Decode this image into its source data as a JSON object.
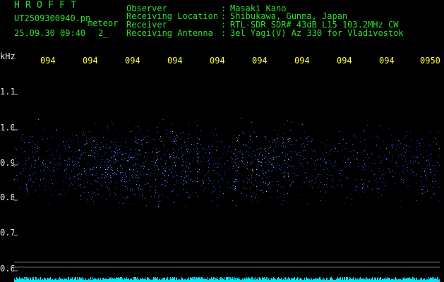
{
  "header": {
    "app_title": "HROFFT",
    "file_name": "UT2509300940.pn",
    "file_suffix": "meteor",
    "timestamp": "25.09.30 09:40",
    "counter": "2_",
    "info": [
      {
        "label": "Observer",
        "sep": ":",
        "value": "Masaki Kano"
      },
      {
        "label": "Receiving Location",
        "sep": ":",
        "value": "Shibukawa, Gunma, Japan"
      },
      {
        "label": "Receiver",
        "sep": ":",
        "value": "RTL-SDR SDR# 43dB L15 103.2MHz CW"
      },
      {
        "label": "Receiving Antenna",
        "sep": ":",
        "value": "3el Yagi(V) Az 330 for Vladivostok"
      }
    ]
  },
  "axis": {
    "y_unit": "kHz",
    "y_ticks": [
      "1.1",
      "1.0",
      "0.9",
      "0.8",
      "0.7",
      "0.6"
    ],
    "time_ticks": [
      "094",
      "094",
      "094",
      "094",
      "094",
      "094",
      "094",
      "094",
      "094",
      "0950"
    ]
  },
  "colors": {
    "background": "#000000",
    "header_text": "#2fe02f",
    "time_labels": "#ffff3a",
    "axis_text": "#e8e8e8",
    "signal": "#2a3cff",
    "noise_floor": "#00e5ff"
  }
}
